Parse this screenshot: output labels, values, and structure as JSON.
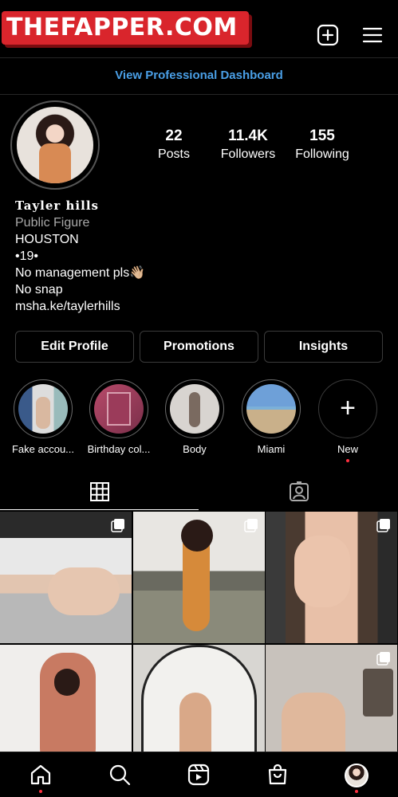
{
  "watermark": {
    "text": "THEFAPPER.COM"
  },
  "top_bar": {
    "new_post_icon": "plus-square-icon",
    "menu_icon": "hamburger-menu-icon"
  },
  "professional_dashboard": {
    "label": "View Professional Dashboard",
    "color": "#4a9fe6"
  },
  "profile": {
    "stats": {
      "posts": {
        "value": "22",
        "label": "Posts"
      },
      "followers": {
        "value": "11.4K",
        "label": "Followers"
      },
      "following": {
        "value": "155",
        "label": "Following"
      }
    },
    "bio": {
      "name": "Tayler hills",
      "category": "Public Figure",
      "lines": [
        "HOUSTON",
        "•19•",
        "No management pls👋🏼",
        "No snap"
      ],
      "link": "msha.ke/taylerhills"
    }
  },
  "actions": {
    "edit_profile": "Edit Profile",
    "promotions": "Promotions",
    "insights": "Insights"
  },
  "highlights": [
    {
      "label": "Fake accou..."
    },
    {
      "label": "Birthday col..."
    },
    {
      "label": "Body"
    },
    {
      "label": "Miami"
    },
    {
      "label": "New"
    }
  ],
  "tabs": {
    "grid_icon": "grid-icon",
    "tagged_icon": "tagged-person-icon"
  },
  "bottom_nav": {
    "home": "home-icon",
    "search": "search-icon",
    "reels": "reels-icon",
    "shop": "shop-bag-icon",
    "profile": "avatar"
  },
  "accent_colors": {
    "notification_dot": "#ff3040",
    "watermark_bg": "#d9252c"
  }
}
